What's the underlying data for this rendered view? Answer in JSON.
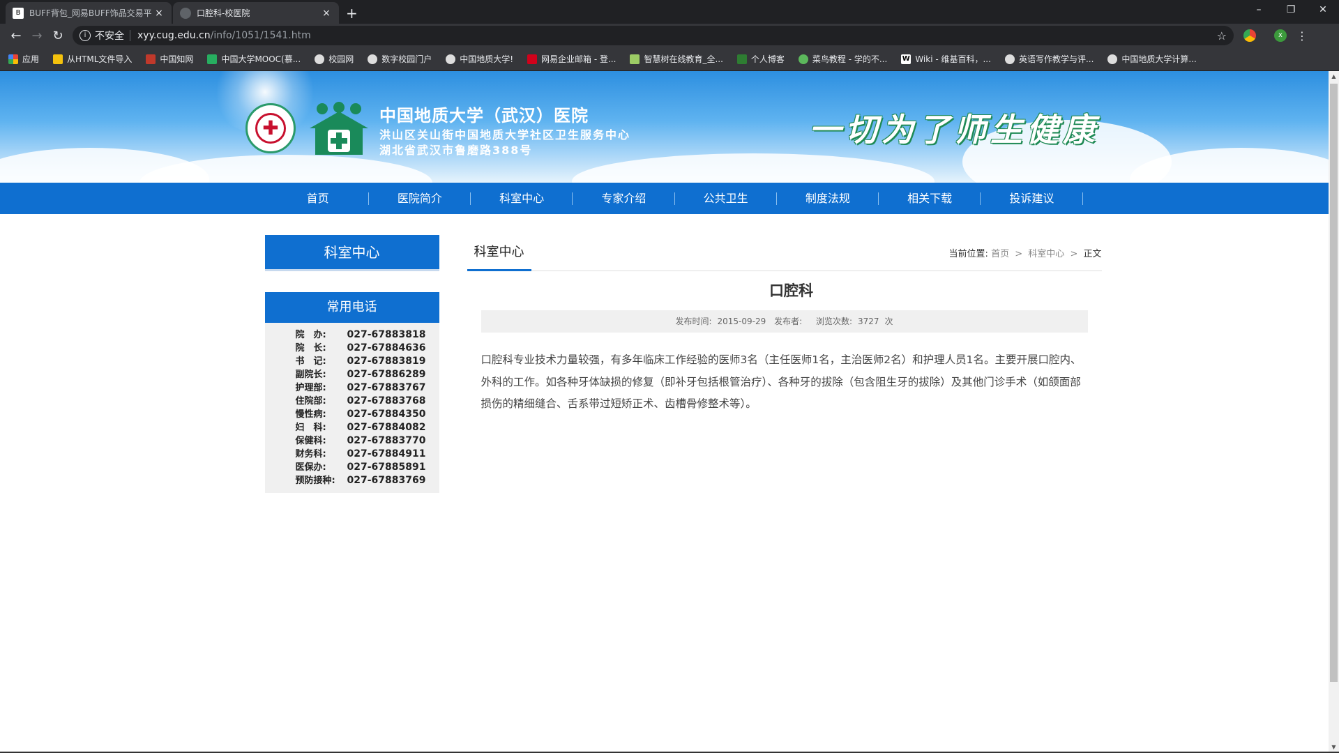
{
  "browser": {
    "tabs": [
      {
        "label": "BUFF背包_网易BUFF饰品交易平",
        "active": false
      },
      {
        "label": "口腔科-校医院",
        "active": true
      }
    ],
    "new_tab": "+",
    "window_controls": {
      "minimize": "–",
      "restore": "❐",
      "close": "✕"
    },
    "omnibox": {
      "security_label": "不安全",
      "host": "xyy.cug.edu.cn",
      "path": "/info/1051/1541.htm"
    },
    "profile_initial": "x",
    "bookmarks": [
      {
        "label": "应用",
        "icon": "apps-grid-icon",
        "color": "#ea4335"
      },
      {
        "label": "从HTML文件导入",
        "icon": "folder-icon",
        "color": "#f4c20d"
      },
      {
        "label": "中国知网",
        "icon": "cnki-icon",
        "color": "#c0392b"
      },
      {
        "label": "中国大学MOOC(慕...",
        "icon": "mooc-icon",
        "color": "#27ae60"
      },
      {
        "label": "校园网",
        "icon": "globe-icon",
        "color": "#dddddd"
      },
      {
        "label": "数字校园门户",
        "icon": "globe-icon",
        "color": "#dddddd"
      },
      {
        "label": "中国地质大学!",
        "icon": "globe-icon",
        "color": "#dddddd"
      },
      {
        "label": "网易企业邮箱 - 登...",
        "icon": "netease-mail-icon",
        "color": "#d0021b"
      },
      {
        "label": "智慧树在线教育_全...",
        "icon": "zhihuishu-icon",
        "color": "#9ccc65"
      },
      {
        "label": "个人博客",
        "icon": "shield-icon",
        "color": "#2e7d32"
      },
      {
        "label": "菜鸟教程 - 学的不...",
        "icon": "runoob-icon",
        "color": "#5cb85c"
      },
      {
        "label": "Wiki - 维基百科，...",
        "icon": "wikipedia-icon",
        "color": "#ffffff"
      },
      {
        "label": "英语写作教学与评...",
        "icon": "globe-icon",
        "color": "#dddddd"
      },
      {
        "label": "中国地质大学计算...",
        "icon": "globe-icon",
        "color": "#dddddd"
      }
    ]
  },
  "header": {
    "title": "中国地质大学（武汉）医院",
    "subtitle1": "洪山区关山街中国地质大学社区卫生服务中心",
    "subtitle2": "湖北省武汉市鲁磨路388号",
    "slogan": "一切为了师生健康"
  },
  "nav": [
    "首页",
    "医院简介",
    "科室中心",
    "专家介绍",
    "公共卫生",
    "制度法规",
    "相关下载",
    "投诉建议"
  ],
  "sidebar": {
    "section_title": "科室中心",
    "phones_title": "常用电话",
    "phones": [
      {
        "label": "院　办:",
        "number": "027-67883818"
      },
      {
        "label": "院　长:",
        "number": "027-67884636"
      },
      {
        "label": "书　记:",
        "number": "027-67883819"
      },
      {
        "label": "副院长:",
        "number": "027-67886289"
      },
      {
        "label": "护理部:",
        "number": "027-67883767"
      },
      {
        "label": "住院部:",
        "number": "027-67883768"
      },
      {
        "label": "慢性病:",
        "number": "027-67884350"
      },
      {
        "label": "妇　科:",
        "number": "027-67884082"
      },
      {
        "label": "保健科:",
        "number": "027-67883770"
      },
      {
        "label": "财务科:",
        "number": "027-67884911"
      },
      {
        "label": "医保办:",
        "number": "027-67885891"
      },
      {
        "label": "预防接种:",
        "number": "027-67883769"
      }
    ]
  },
  "main": {
    "section_tab": "科室中心",
    "breadcrumb": {
      "prefix": "当前位置:",
      "home": "首页",
      "section": "科室中心",
      "current": "正文",
      "separator": ">"
    },
    "article": {
      "title": "口腔科",
      "publish_label": "发布时间:",
      "publish_date": "2015-09-29",
      "author_label": "发布者:",
      "author": "",
      "views_label": "浏览次数:",
      "views": "3727",
      "views_unit": "次",
      "body": "口腔科专业技术力量较强，有多年临床工作经验的医师3名（主任医师1名，主治医师2名）和护理人员1名。主要开展口腔内、外科的工作。如各种牙体缺损的修复（即补牙包括根管治疗）、各种牙的拔除（包含阻生牙的拔除）及其他门诊手术（如颌面部损伤的精细缝合、舌系带过短矫正术、齿槽骨修整术等）。"
    }
  },
  "colors": {
    "primary_blue": "#0f6fd0",
    "chrome_dark": "#202124",
    "chrome_mid": "#35363a"
  }
}
